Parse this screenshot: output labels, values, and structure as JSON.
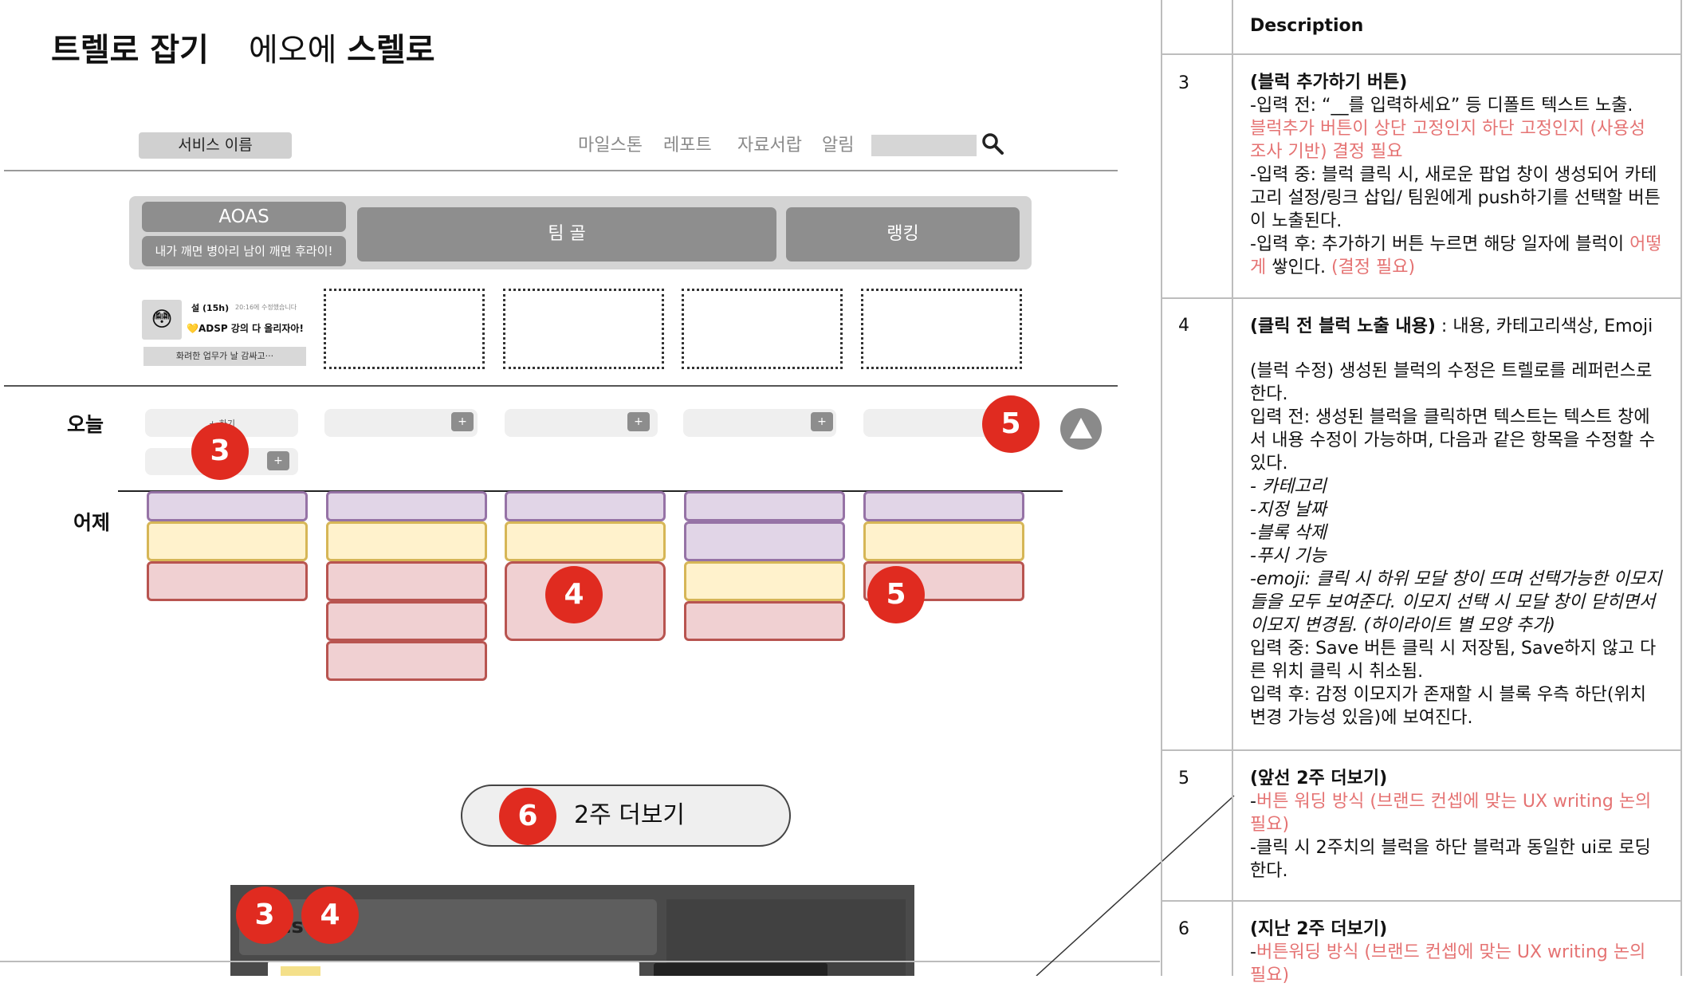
{
  "title": {
    "main": "트렐로 잡기",
    "sub_prefix": "에오에 ",
    "sub_bold": "스렐로"
  },
  "header": {
    "service_name": "서비스 이름",
    "nav": [
      "마일스톤",
      "레포트",
      "자료서랍",
      "알림"
    ]
  },
  "tabs": {
    "aoas_title": "AOAS",
    "aoas_sub": "내가 깨면 병아리 남이 깨면 후라이!",
    "team": "팀 골",
    "ranking": "랭킹"
  },
  "profile": {
    "avatar": "😳",
    "name": "설  (15h)",
    "time": "20:16에 수정했습니다",
    "line": "💛ADSP 강의 다 올리자아!",
    "button": "화려한 업무가 날 감싸고···"
  },
  "rows": {
    "today": "오늘",
    "yesterday": "어제"
  },
  "today_hint": "+ 하기",
  "plus": "+",
  "badges": {
    "b3": "3",
    "b4": "4",
    "b5": "5",
    "b6": "6"
  },
  "more_button": "2주 더보기",
  "dark_panel_text": "cs",
  "table": {
    "header": "Description",
    "rows": [
      {
        "num": "3",
        "title": "(블럭 추가하기 버튼)",
        "l1": "-입력 전: “__를 입력하세요” 등 디폴트 텍스트 노출.",
        "l2_red": "블럭추가 버튼이 상단 고정인지 하단 고정인지 (사용성 조사 기반) 결정 필요",
        "l3": "-입력 중: 블럭 클릭 시, 새로운 팝업 창이 생성되어 카테고리 설정/링크 삽입/ 팀원에게 push하기를 선택할 버튼이 노출된다.",
        "l4a": "-입력 후: 추가하기 버튼 누르면 해당 일자에 블럭이 ",
        "l4b_red": "어떻게",
        "l4c": " 쌓인다. ",
        "l4d_red": "(결정 필요)"
      },
      {
        "num": "4",
        "title": "(클릭 전 블럭 노출 내용)",
        "title_rest": " : 내용, 카테고리색상, Emoji",
        "p1": "(블럭 수정) 생성된 블럭의 수정은 트렐로를 레퍼런스로 한다.",
        "p2": "입력 전: 생성된 블럭을 클릭하면 텍스트는 텍스트 창에서 내용 수정이 가능하며, 다음과 같은 항목을 수정할 수 있다.",
        "i1": "- 카테고리",
        "i2": "-지정 날짜",
        "i3": "-블록 삭제",
        "i4": "-푸시 기능",
        "i5": "-emoji: 클릭 시 하위 모달 창이 뜨며 선택가능한 이모지들을 모두 보여준다. 이모지 선택 시 모달 창이 닫히면서 이모지 변경됨. (하이라이트 별 모양 추가)",
        "p3": "입력 중: Save 버튼 클릭 시 저장됨, Save하지 않고 다른 위치 클릭 시 취소됨.",
        "p4": "입력 후: 감정 이모지가 존재할 시 블록 우측 하단(위치 변경 가능성 있음)에 보여진다."
      },
      {
        "num": "5",
        "title": "(앞선 2주 더보기)",
        "l1a": "-",
        "l1b_red": "버튼 워딩 방식 (브랜드 컨셉에 맞는 UX writing 논의 필요)",
        "l2": "-클릭 시 2주치의 블럭을 하단 블럭과 동일한 ui로 로딩한다."
      },
      {
        "num": "6",
        "title": "(지난 2주 더보기)",
        "l1a": "-",
        "l1b_red": "버튼워딩  방식 (브랜드 컨셉에 맞는 UX writing 논의 필요)"
      }
    ]
  }
}
